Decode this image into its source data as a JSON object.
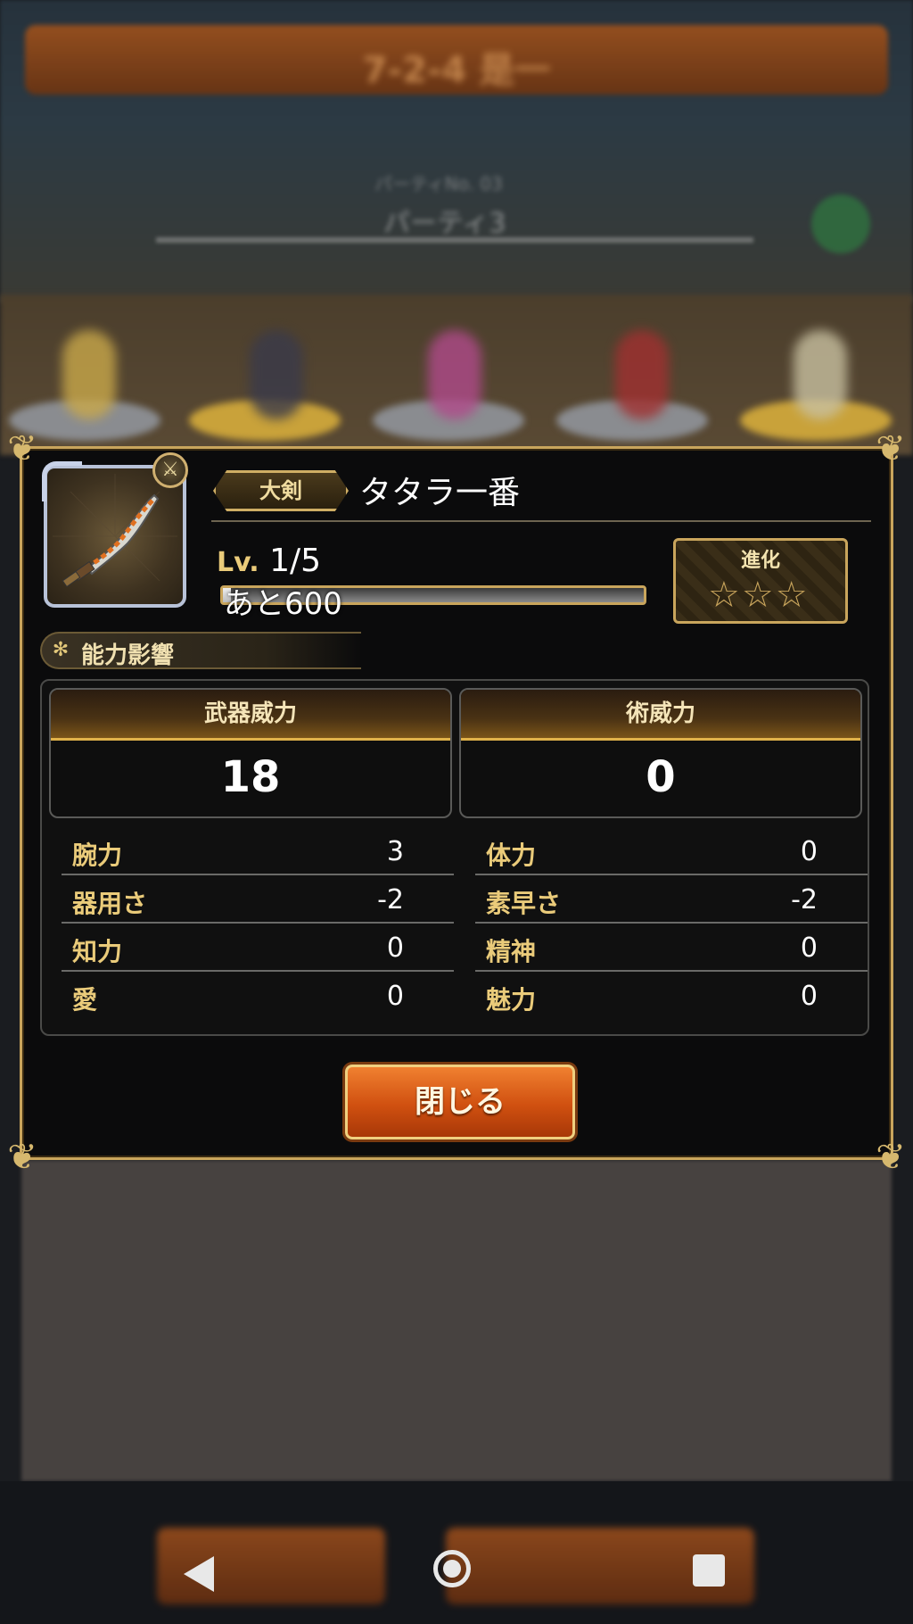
{
  "background": {
    "header_title": "7-2-4 是一",
    "party_sub": "パーティNo. 03",
    "party_name": "パーティ3"
  },
  "weapon": {
    "type": "大剣",
    "name": "タタラ一番",
    "level_prefix": "Lv.",
    "level": "1/5",
    "exp_remaining": "あと600",
    "exp_progress": 0.02,
    "evolution_label": "進化",
    "evolution_stars_filled": 0,
    "evolution_stars_total": 3,
    "evolution_stars": "☆☆☆",
    "icon": "greatsword-icon"
  },
  "section": {
    "title": "能力影響",
    "icon": "gear-icon"
  },
  "power": {
    "weapon_label": "武器威力",
    "weapon_value": "18",
    "magic_label": "術威力",
    "magic_value": "0"
  },
  "stats": {
    "left": [
      {
        "label": "腕力",
        "value": "3"
      },
      {
        "label": "器用さ",
        "value": "-2"
      },
      {
        "label": "知力",
        "value": "0"
      },
      {
        "label": "愛",
        "value": "0"
      }
    ],
    "right": [
      {
        "label": "体力",
        "value": "0"
      },
      {
        "label": "素早さ",
        "value": "-2"
      },
      {
        "label": "精神",
        "value": "0"
      },
      {
        "label": "魅力",
        "value": "0"
      }
    ]
  },
  "close_button": "閉じる",
  "colors": {
    "gold": "#c9a55c",
    "accent_orange": "#d05010",
    "panel": "#0b0b0c"
  }
}
